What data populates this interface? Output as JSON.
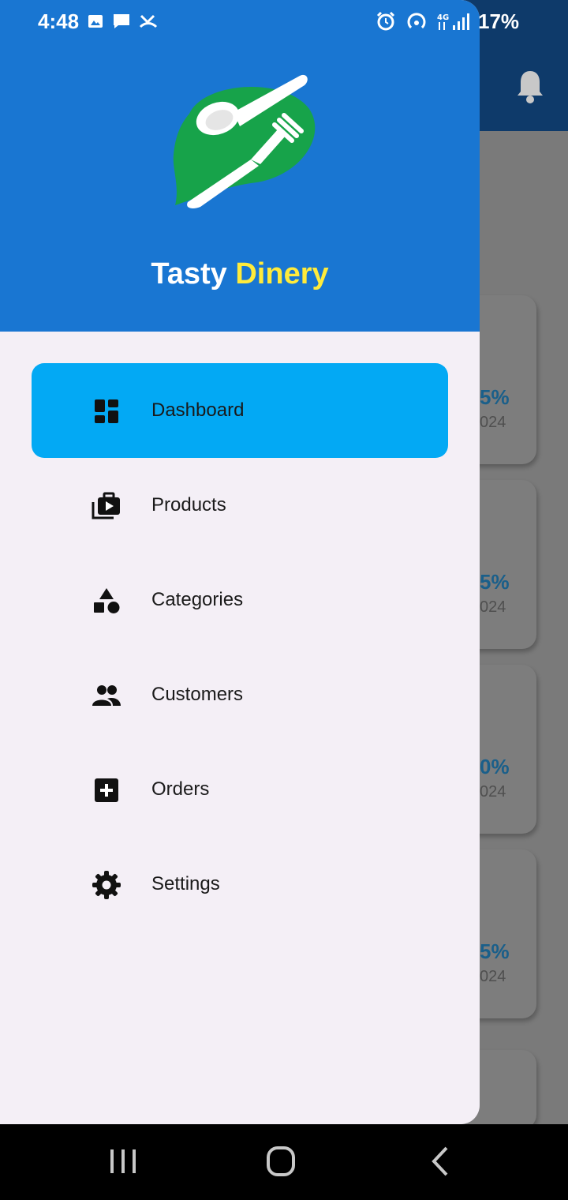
{
  "status_bar": {
    "time": "4:48",
    "battery": "17%"
  },
  "background": {
    "cards": [
      {
        "pct": "5%",
        "year": "024"
      },
      {
        "pct": "5%",
        "year": "024"
      },
      {
        "pct": "0%",
        "year": "024"
      },
      {
        "pct": "5%",
        "year": "024"
      }
    ]
  },
  "drawer": {
    "brand_first": "Tasty",
    "brand_second": "Dinery",
    "items": [
      {
        "label": "Dashboard",
        "icon": "dashboard-icon",
        "active": true
      },
      {
        "label": "Products",
        "icon": "products-icon",
        "active": false
      },
      {
        "label": "Categories",
        "icon": "categories-icon",
        "active": false
      },
      {
        "label": "Customers",
        "icon": "customers-icon",
        "active": false
      },
      {
        "label": "Orders",
        "icon": "orders-icon",
        "active": false
      },
      {
        "label": "Settings",
        "icon": "settings-icon",
        "active": false
      }
    ]
  },
  "colors": {
    "header": "#1976d2",
    "active_item": "#03a9f4",
    "brand_accent": "#ffeb3b",
    "drawer_bg": "#f4eff6"
  }
}
